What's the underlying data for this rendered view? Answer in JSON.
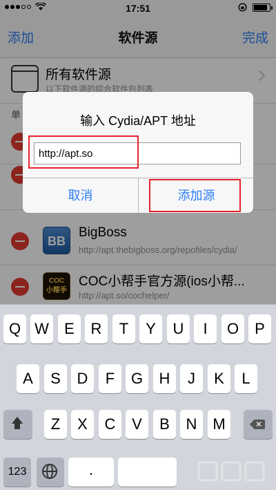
{
  "status_bar": {
    "time": "17:51"
  },
  "nav": {
    "left": "添加",
    "title": "软件源",
    "right": "完成"
  },
  "all_sources": {
    "title": "所有软件源",
    "subtitle": "以下软件源的综合软件包列表"
  },
  "section_header": "单",
  "sources": [
    {
      "title": "BigBoss",
      "url": "http://apt.thebigboss.org/repofiles/cydia/",
      "icon": "BB"
    },
    {
      "title": "COC小帮手官方源(ios小帮...",
      "url": "http://apt.so/cochelper/",
      "icon": "COC\n小帮手"
    }
  ],
  "dialog": {
    "title": "输入 Cydia/APT 地址",
    "input_value": "http://apt.so",
    "cancel": "取消",
    "add": "添加源"
  },
  "keyboard": {
    "row1": [
      "Q",
      "W",
      "E",
      "R",
      "T",
      "Y",
      "U",
      "I",
      "O",
      "P"
    ],
    "row2": [
      "A",
      "S",
      "D",
      "F",
      "G",
      "H",
      "J",
      "K",
      "L"
    ],
    "row3": [
      "Z",
      "X",
      "C",
      "V",
      "B",
      "N",
      "M"
    ],
    "num_key": "123",
    "dot_key": "."
  },
  "colors": {
    "accent": "#2b7cf6",
    "delete_red": "#e23b30",
    "highlight": "#e8212c"
  }
}
